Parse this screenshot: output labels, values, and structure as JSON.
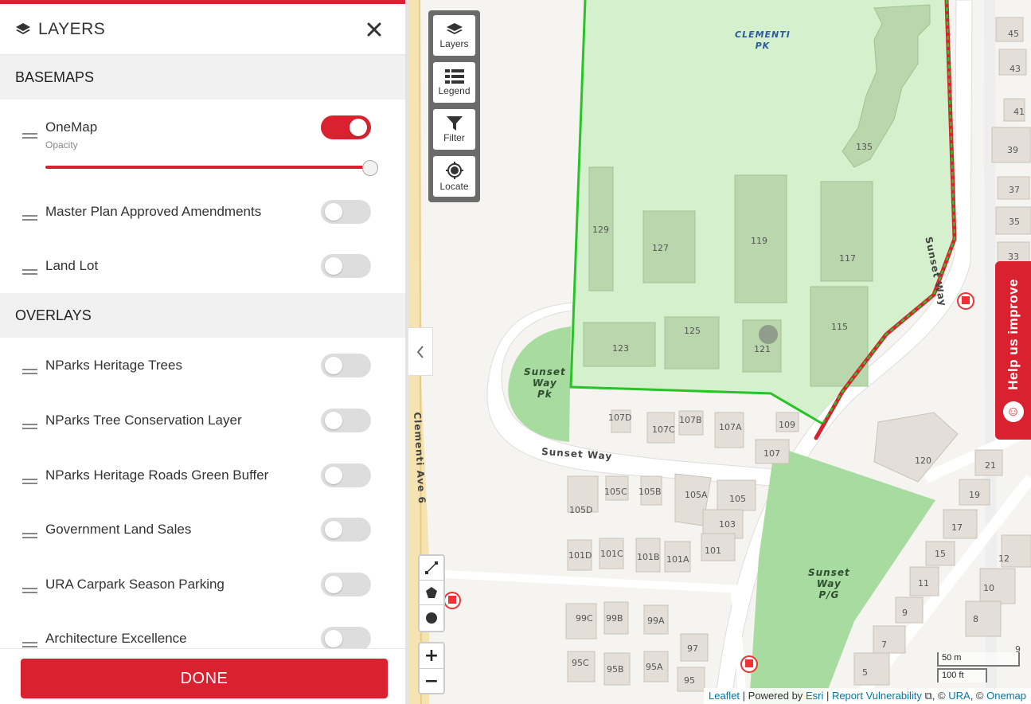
{
  "sidebar": {
    "title": "LAYERS",
    "basemaps_heading": "BASEMAPS",
    "overlays_heading": "OVERLAYS",
    "basemaps": [
      {
        "label": "OneMap",
        "on": true,
        "opacity_label": "Opacity",
        "opacity": 1.0
      },
      {
        "label": "Master Plan Approved Amendments",
        "on": false
      },
      {
        "label": "Land Lot",
        "on": false
      }
    ],
    "overlays": [
      {
        "label": "NParks Heritage Trees",
        "on": false
      },
      {
        "label": "NParks Tree Conservation Layer",
        "on": false
      },
      {
        "label": "NParks Heritage Roads Green Buffer",
        "on": false
      },
      {
        "label": "Government Land Sales",
        "on": false
      },
      {
        "label": "URA Carpark Season Parking",
        "on": false
      },
      {
        "label": "Architecture Excellence",
        "on": false
      }
    ],
    "done_label": "DONE"
  },
  "map_controls": {
    "layers": "Layers",
    "legend": "Legend",
    "filter": "Filter",
    "locate": "Locate",
    "zoom_in": "+",
    "zoom_out": "−"
  },
  "map": {
    "park_labels": {
      "clementi_pk": [
        "CLEMENTI",
        "PK"
      ],
      "sunset_way_pk": [
        "Sunset",
        "Way",
        "Pk"
      ],
      "sunset_way_pg": [
        "Sunset",
        "Way",
        "P/G"
      ]
    },
    "road_labels": {
      "sunset_way_bottom": "Sunset Way",
      "sunset_way_side": "Sunset Way",
      "clementi_ave_6": "Clementi Ave 6"
    },
    "blocks": [
      "45",
      "43",
      "41",
      "39",
      "37",
      "35",
      "33",
      "135",
      "129",
      "127",
      "119",
      "117",
      "115",
      "125",
      "123",
      "121",
      "107D",
      "107C",
      "107B",
      "107A",
      "109",
      "107",
      "120",
      "21",
      "19",
      "17",
      "15",
      "12",
      "11",
      "10",
      "9",
      "8",
      "7",
      "5",
      "9",
      "105C",
      "105B",
      "105A",
      "105",
      "105D",
      "103",
      "101",
      "101D",
      "101C",
      "101B",
      "101A",
      "99C",
      "99B",
      "99A",
      "97",
      "95C",
      "95B",
      "95A",
      "95"
    ]
  },
  "help_tab": {
    "label": "Help us improve",
    "icon": "smiley-icon"
  },
  "scale": {
    "top": "50 m",
    "bottom": "100 ft"
  },
  "attribution": {
    "leaflet": "Leaflet",
    "powered_by": "Powered by",
    "esri": "Esri",
    "report": "Report Vulnerability",
    "copyright_ura": "URA",
    "copyright_onemap": "Onemap",
    "sep1": " | ",
    "sep2": " | ",
    "copy_prefix1": ", © ",
    "copy_prefix2": ", © "
  },
  "colors": {
    "accent": "#d9212f",
    "park": "#a8dba0",
    "park_light": "#d4f0cd",
    "building_park": "#b9d6ad",
    "building": "#e6e1dc",
    "boundary": "#27c327"
  }
}
